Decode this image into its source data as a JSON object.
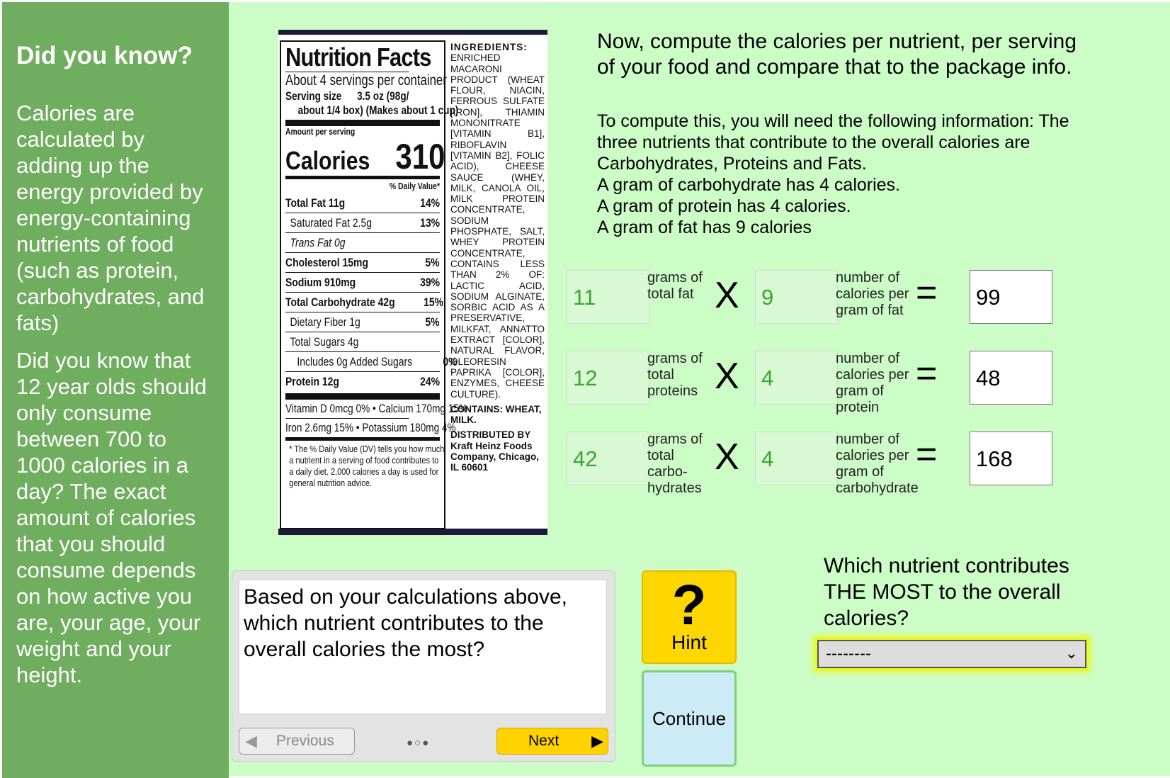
{
  "sidebar": {
    "title": "Did you know?",
    "para1": "Calories are calculated by adding up the energy provided by energy-containing nutrients of food (such as protein, carbohydrates, and fats)",
    "para2": "Did you know that 12 year olds should only consume between 700 to 1000 calories in a day? The exact amount of calories that you should consume depends on how active you are, your age, your weight and your height."
  },
  "label": {
    "title": "Nutrition Facts",
    "servings": "About 4 servings per container",
    "serving_size_label": "Serving size",
    "serving_size_value": "3.5 oz (98g/",
    "serving_size_note": "about 1/4 box) (Makes about 1 cup)",
    "amount_per_serving": "Amount per serving",
    "calories_label": "Calories",
    "calories_value": "310",
    "daily_value": "% Daily Value*",
    "rows": [
      {
        "name": "Total Fat 11g",
        "dv": "14%"
      },
      {
        "name": "Saturated Fat 2.5g",
        "dv": "13%"
      },
      {
        "name": "Trans Fat 0g",
        "dv": ""
      },
      {
        "name": "Cholesterol 15mg",
        "dv": "5%"
      },
      {
        "name": "Sodium 910mg",
        "dv": "39%"
      },
      {
        "name": "Total Carbohydrate 42g",
        "dv": "15%"
      },
      {
        "name": "Dietary Fiber 1g",
        "dv": "5%"
      },
      {
        "name": "Total Sugars 4g",
        "dv": ""
      },
      {
        "name": "Includes 0g Added Sugars",
        "dv": "0%"
      },
      {
        "name": "Protein 12g",
        "dv": "24%"
      }
    ],
    "vitamins1": "Vitamin D 0mcg 0% • Calcium 170mg 15%",
    "vitamins2": "Iron 2.6mg 15% • Potassium 180mg 4%",
    "footnote": "* The % Daily Value (DV) tells you how much a nutrient in a serving of food contributes to a daily diet. 2,000 calories a day is used for general nutrition advice.",
    "ingredients_title": "INGREDIENTS:",
    "ingredients": "ENRICHED MACARONI PRODUCT (WHEAT FLOUR, NIACIN, FERROUS SULFATE [IRON], THIAMIN MONONITRATE [VITAMIN B1], RIBOFLAVIN [VITAMIN B2], FOLIC ACID), CHEESE SAUCE (WHEY, MILK, CANOLA OIL, MILK PROTEIN CONCENTRATE, SODIUM PHOSPHATE, SALT, WHEY PROTEIN CONCENTRATE, CONTAINS LESS THAN 2% OF: LACTIC ACID, SODIUM ALGINATE, SORBIC ACID AS A PRESERVATIVE, MILKFAT, ANNATTO EXTRACT [COLOR], NATURAL FLAVOR, OLEORESIN PAPRIKA [COLOR], ENZYMES, CHEESE CULTURE).",
    "contains": "CONTAINS: WHEAT, MILK.",
    "distributed": "DISTRIBUTED BY Kraft Heinz Foods Company, Chicago, IL 60601"
  },
  "instructions": {
    "heading": "Now, compute the calories per nutrient, per serving of your food and compare that to the package info.",
    "lines": [
      "To compute this, you will need the following information: The",
      "three nutrients that contribute to the overall calories are",
      "Carbohydrates, Proteins and Fats.",
      "A gram of carbohydrate has 4 calories.",
      "A gram of protein has 4 calories.",
      "A gram of fat has 9 calories"
    ]
  },
  "equations": [
    {
      "grams": "11",
      "grams_label": "grams of total fat",
      "factor": "9",
      "factor_label": "number of calories per gram of fat",
      "result": "99"
    },
    {
      "grams": "12",
      "grams_label": "grams of total proteins",
      "factor": "4",
      "factor_label": "number of calories per gram of protein",
      "result": "48"
    },
    {
      "grams": "42",
      "grams_label": "grams of total carbo-hydrates",
      "factor": "4",
      "factor_label": "number of calories per gram of carbohydrate",
      "result": "168"
    }
  ],
  "ops": {
    "times": "X",
    "equals": "="
  },
  "question_panel": {
    "text": "Based on your calculations above, which nutrient contributes to the overall calories the most?",
    "previous": "Previous",
    "next": "Next",
    "dots": "●○●"
  },
  "hint": {
    "symbol": "?",
    "label": "Hint"
  },
  "continue_label": "Continue",
  "question2": "Which nutrient contributes THE MOST to the overall calories?",
  "select_value": "--------",
  "colors": {
    "sidebar": "#6fad5f",
    "main_bg": "#ccfdc6",
    "hint": "#ffd700",
    "continue": "#cdebf7",
    "given_text": "#3aa62f"
  }
}
